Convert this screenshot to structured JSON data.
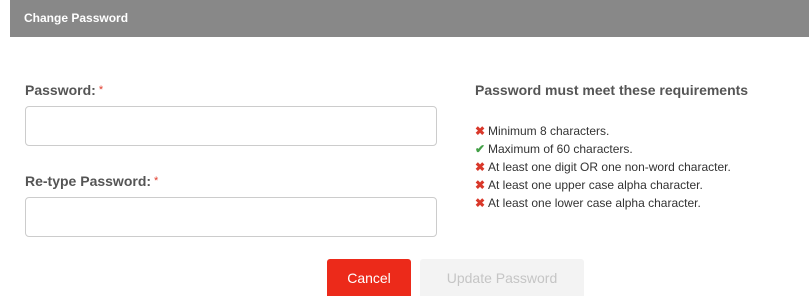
{
  "dialog": {
    "title": "Change Password"
  },
  "form": {
    "password_label": "Password:",
    "retype_label": "Re-type Password:",
    "required_marker": "*",
    "password_value": "",
    "retype_value": ""
  },
  "requirements": {
    "heading": "Password must meet these requirements",
    "items": [
      {
        "text": "Minimum 8 characters.",
        "status": "fail",
        "icon": "✖"
      },
      {
        "text": "Maximum of 60 characters.",
        "status": "pass",
        "icon": "✔"
      },
      {
        "text": "At least one digit OR one non-word character.",
        "status": "fail",
        "icon": "✖"
      },
      {
        "text": "At least one upper case alpha character.",
        "status": "fail",
        "icon": "✖"
      },
      {
        "text": "At least one lower case alpha character.",
        "status": "fail",
        "icon": "✖"
      }
    ]
  },
  "buttons": {
    "cancel_label": "Cancel",
    "update_label": "Update Password",
    "update_disabled": true
  },
  "colors": {
    "titlebar": "#888888",
    "required": "#e03a2a",
    "fail": "#d9382a",
    "pass": "#43a047",
    "cancel": "#ec2a1a",
    "disabled": "#f3f3f3"
  }
}
